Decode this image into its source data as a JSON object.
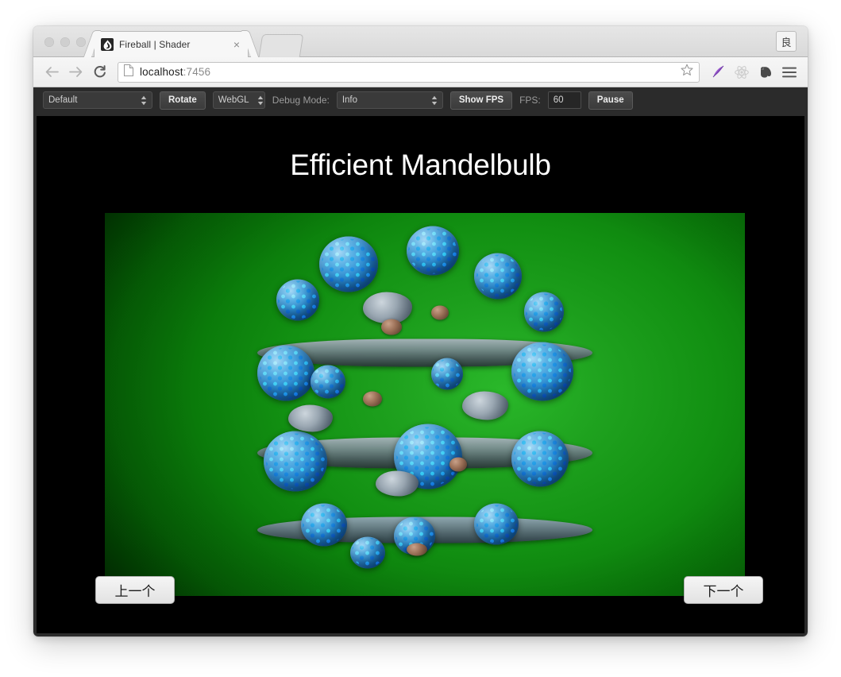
{
  "window": {
    "traffic_lights": [
      "close",
      "minimize",
      "zoom"
    ],
    "profile_badge": "良"
  },
  "tab": {
    "title": "Fireball | Shader",
    "close_label": "×",
    "favicon_name": "fireball-droplet-icon"
  },
  "nav": {
    "back_label": "←",
    "forward_label": "→",
    "reload_label": "⟳",
    "url": "localhost",
    "url_port": ":7456",
    "star_label": "☆"
  },
  "extensions": [
    {
      "name": "quill-extension-icon",
      "color": "#8e44c8"
    },
    {
      "name": "react-devtools-icon",
      "color": "#c9c9c9"
    },
    {
      "name": "evernote-extension-icon",
      "color": "#4a4a4a"
    },
    {
      "name": "chrome-menu-icon",
      "color": "#5a5a5a"
    }
  ],
  "app_toolbar": {
    "scene_select": {
      "value": "Default"
    },
    "rotate_button": "Rotate",
    "renderer_select": {
      "value": "WebGL"
    },
    "debug_mode_label": "Debug Mode:",
    "debug_mode_select": {
      "value": "Info"
    },
    "show_fps_button": "Show FPS",
    "fps_label": "FPS:",
    "fps_value": "60",
    "pause_button": "Pause"
  },
  "stage": {
    "title": "Efficient Mandelbulb",
    "prev_button": "上一个",
    "next_button": "下一个",
    "background_color": "#000000",
    "canvas_color_center": "#2ab82a",
    "canvas_color_edge": "#012701"
  }
}
